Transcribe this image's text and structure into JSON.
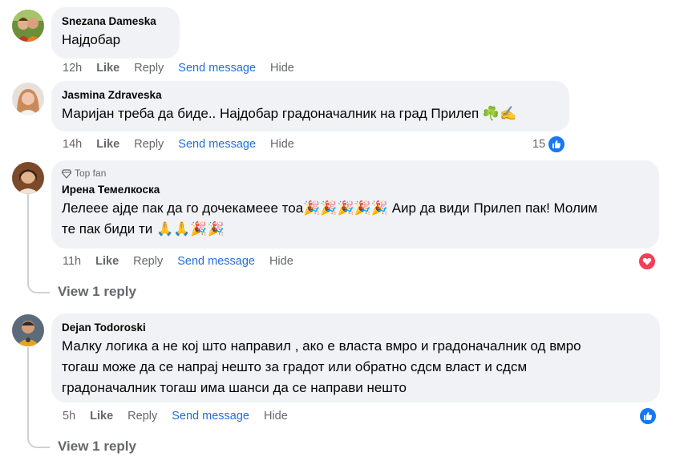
{
  "comments": [
    {
      "author": "Snezana Dameska",
      "text_lines": [
        "Најдобар"
      ],
      "time": "12h",
      "like": "Like",
      "reply": "Reply",
      "send_message": "Send message",
      "hide": "Hide"
    },
    {
      "author": "Jasmina Zdraveska",
      "text_lines": [
        "Маријан треба да биде.. Најдобар градоначалник на град Прилеп ☘️✍️"
      ],
      "time": "14h",
      "like": "Like",
      "reply": "Reply",
      "send_message": "Send message",
      "hide": "Hide",
      "reaction_count": "15",
      "reaction_icon": "like-icon"
    },
    {
      "badge": "Top fan",
      "author": "Ирена Темелкоска",
      "text_lines": [
        "Лелеее ајде пак да го дочекамеее тоа🎉🎉🎉🎉🎉 Аир да види Прилеп пак! Молим",
        "те пак биди ти 🙏🙏🎉🎉"
      ],
      "time": "11h",
      "like": "Like",
      "reply": "Reply",
      "send_message": "Send message",
      "hide": "Hide",
      "reaction_icon": "love-icon",
      "view_replies": "View 1 reply"
    },
    {
      "author": "Dejan Todoroski",
      "text_lines": [
        "Малку логика а не кој што направил , ако е власта вмро и градоначалник од вмро",
        "тогаш може да се напрај нешто за градот или обратно сдсм власт и сдсм",
        "градоначалник тогаш има шанси да се направи нешто"
      ],
      "time": "5h",
      "like": "Like",
      "reply": "Reply",
      "send_message": "Send message",
      "hide": "Hide",
      "reaction_icon": "like-icon",
      "view_replies": "View 1 reply"
    }
  ],
  "colors": {
    "bubble": "#f0f2f5",
    "secondary_text": "#65676b",
    "link": "#216fdb",
    "like_blue": "#1877f2",
    "love_red": "#f33e58"
  }
}
